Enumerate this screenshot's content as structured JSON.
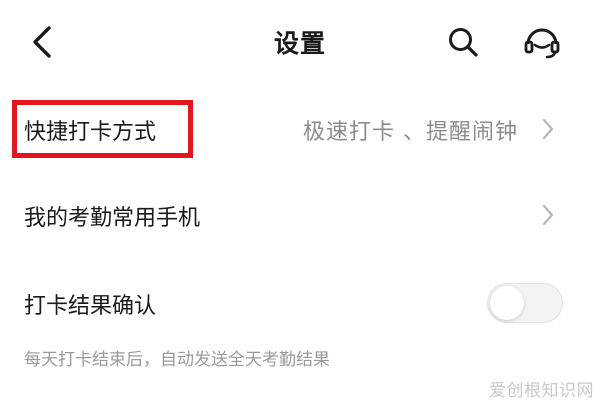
{
  "header": {
    "title": "设置",
    "back_icon": "chevron-left-icon",
    "search_icon": "search-icon",
    "service_icon": "headset-icon"
  },
  "settings": {
    "quick_checkin": {
      "label": "快捷打卡方式",
      "value": "极速打卡 、提醒闹钟"
    },
    "common_phone": {
      "label": "我的考勤常用手机"
    },
    "result_confirm": {
      "label": "打卡结果确认",
      "toggle_on": false,
      "description": "每天打卡结束后，自动发送全天考勤结果"
    }
  },
  "highlight": {
    "color": "#e5161b"
  },
  "watermark": {
    "text": "爱创根知识网"
  }
}
